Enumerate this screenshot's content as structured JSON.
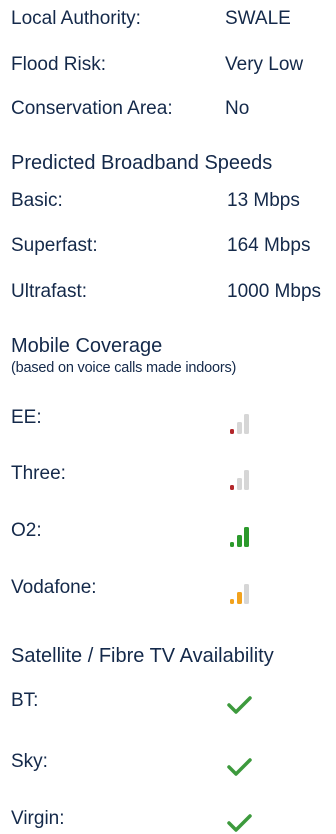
{
  "property_info": {
    "local_authority": {
      "label": "Local Authority:",
      "value": "SWALE"
    },
    "flood_risk": {
      "label": "Flood Risk:",
      "value": "Very Low"
    },
    "conservation_area": {
      "label": "Conservation Area:",
      "value": "No"
    }
  },
  "broadband": {
    "heading": "Predicted Broadband Speeds",
    "rows": [
      {
        "label": "Basic:",
        "value": "13 Mbps"
      },
      {
        "label": "Superfast:",
        "value": "164 Mbps"
      },
      {
        "label": "Ultrafast:",
        "value": "1000 Mbps"
      }
    ]
  },
  "mobile": {
    "heading": "Mobile Coverage",
    "subheading": "(based on voice calls made indoors)",
    "rows": [
      {
        "label": "EE:",
        "bars": 1,
        "color": "#b3262a",
        "icon": "signal-strength-icon"
      },
      {
        "label": "Three:",
        "bars": 1,
        "color": "#b3262a",
        "icon": "signal-strength-icon"
      },
      {
        "label": "O2:",
        "bars": 3,
        "color": "#2c9a2c",
        "icon": "signal-strength-icon"
      },
      {
        "label": "Vodafone:",
        "bars": 2,
        "color": "#f2a21d",
        "icon": "signal-strength-icon"
      }
    ]
  },
  "tv": {
    "heading": "Satellite / Fibre TV Availability",
    "rows": [
      {
        "label": "BT:",
        "available": true,
        "icon": "checkmark-icon"
      },
      {
        "label": "Sky:",
        "available": true,
        "icon": "checkmark-icon"
      },
      {
        "label": "Virgin:",
        "available": true,
        "icon": "checkmark-icon"
      }
    ]
  },
  "colors": {
    "text": "#14294a",
    "check": "#3d9a3d",
    "inactive_bar": "#d6d6d6"
  }
}
